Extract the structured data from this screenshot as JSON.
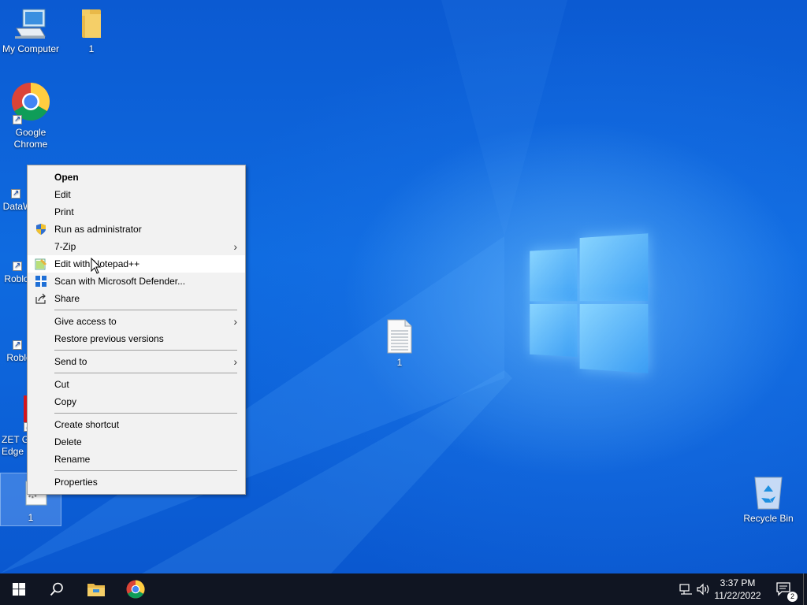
{
  "desktop": {
    "icons": [
      {
        "label": "My Computer",
        "icon": "computer-icon"
      },
      {
        "label": "1",
        "icon": "folder-icon"
      },
      {
        "label": "Google Chrome",
        "icon": "chrome-icon"
      },
      {
        "label": "DataW",
        "icon": "app-icon"
      },
      {
        "label": "Roblox",
        "icon": "roblox-icon"
      },
      {
        "label": "Roblo",
        "icon": "roblox-studio-icon"
      },
      {
        "label": "ZET G Edge",
        "icon": "zet-icon"
      },
      {
        "label": "1",
        "icon": "settings-file-icon"
      },
      {
        "label": "1",
        "icon": "text-file-icon"
      },
      {
        "label": "Recycle Bin",
        "icon": "recycle-bin-icon"
      }
    ]
  },
  "context_menu": {
    "items": [
      {
        "label": "Open",
        "bold": true
      },
      {
        "label": "Edit"
      },
      {
        "label": "Print"
      },
      {
        "label": "Run as administrator",
        "icon": "shield-icon"
      },
      {
        "label": "7-Zip",
        "submenu": true
      },
      {
        "label": "Edit with Notepad++",
        "icon": "notepadpp-icon",
        "highlighted": true
      },
      {
        "label": "Scan with Microsoft Defender...",
        "icon": "defender-icon"
      },
      {
        "label": "Share",
        "icon": "share-icon"
      },
      {
        "label": "Give access to",
        "submenu": true
      },
      {
        "label": "Restore previous versions"
      },
      {
        "label": "Send to",
        "submenu": true
      },
      {
        "label": "Cut"
      },
      {
        "label": "Copy"
      },
      {
        "label": "Create shortcut"
      },
      {
        "label": "Delete"
      },
      {
        "label": "Rename"
      },
      {
        "label": "Properties"
      }
    ]
  },
  "taskbar": {
    "clock": {
      "time": "3:37 PM",
      "date": "11/22/2022"
    },
    "notification_count": "2"
  },
  "colors": {
    "taskbar_bg": "#101522",
    "menu_bg": "#f2f2f2",
    "wallpaper": "#0b5ad2"
  }
}
